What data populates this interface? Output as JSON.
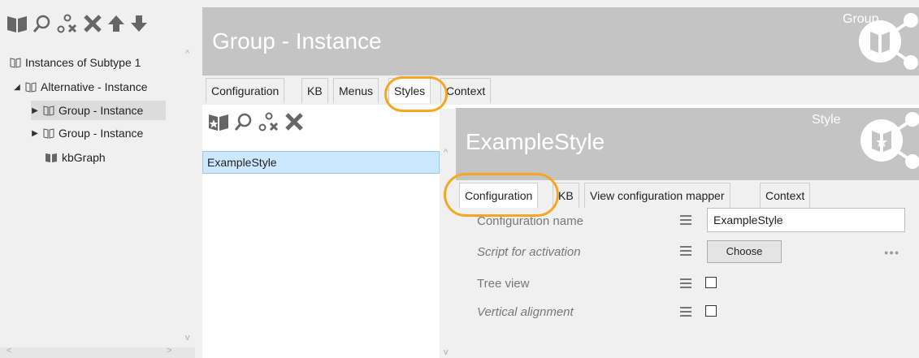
{
  "left_panel": {
    "toolbar_icons": [
      "book-icon",
      "search-icon",
      "node-delete-icon",
      "close-icon",
      "arrow-up-icon",
      "arrow-down-icon"
    ],
    "tree": [
      {
        "label": "Instances of Subtype 1",
        "indent": 0,
        "arrow": ""
      },
      {
        "label": "Alternative - Instance",
        "indent": 1,
        "arrow": "◢"
      },
      {
        "label": "Group - Instance",
        "indent": 2,
        "arrow": "▶",
        "selected": true
      },
      {
        "label": "Group - Instance",
        "indent": 2,
        "arrow": "▶"
      },
      {
        "label": "kbGraph",
        "indent": 2,
        "arrow": ""
      }
    ]
  },
  "main": {
    "title": "Group - Instance",
    "kind": "Group",
    "tabs": [
      "Configuration",
      "KB",
      "Menus",
      "Styles",
      "Context"
    ],
    "active_tab": "Styles"
  },
  "styles_list": {
    "items": [
      "ExampleStyle"
    ]
  },
  "style_panel": {
    "title": "ExampleStyle",
    "kind": "Style",
    "tabs": [
      "Configuration",
      "KB",
      "View configuration mapper",
      "Context"
    ],
    "active_tab": "Configuration",
    "properties": {
      "configuration_name": {
        "label": "Configuration name",
        "value": "ExampleStyle"
      },
      "script_for_activation": {
        "label": "Script for activation",
        "button": "Choose"
      },
      "tree_view": {
        "label": "Tree view",
        "checked": false
      },
      "vertical_alignment": {
        "label": "Vertical alignment",
        "checked": false
      }
    },
    "more_label": "●●●"
  },
  "colors": {
    "highlight": "#f5a623",
    "header_gray": "#c4c4c4",
    "selection": "#cce8ff"
  }
}
